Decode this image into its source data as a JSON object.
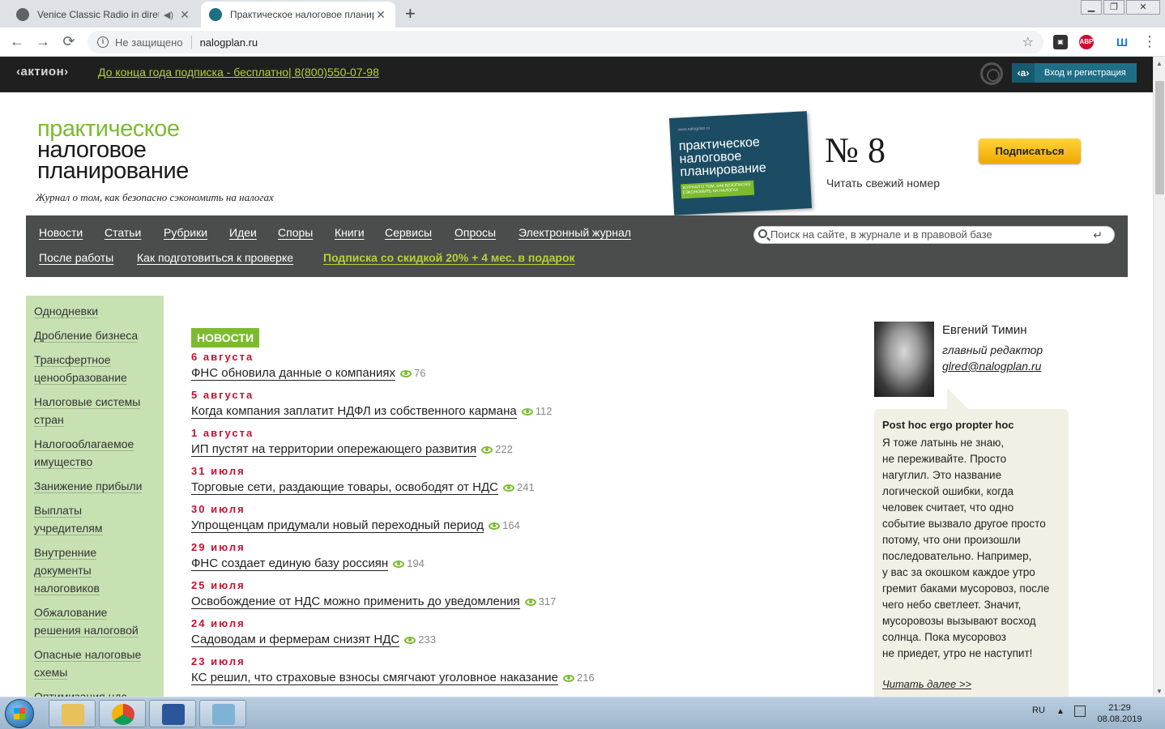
{
  "browser": {
    "tabs": [
      {
        "title": "Venice Classic Radio in diretta",
        "favicon_color": "#5f6368",
        "audio": "◀)",
        "close": "✕"
      },
      {
        "title": "Практическое налоговое планир",
        "favicon_color": "#1e6f86",
        "close": "✕"
      }
    ],
    "new_tab": "+",
    "window_buttons": {
      "minimize": "▁",
      "restore": "❐",
      "close": "✕"
    },
    "nav": {
      "back": "←",
      "forward": "→",
      "reload": "⟳"
    },
    "address": {
      "info": "i",
      "security_label": "Не защищено",
      "url": "nalogplan.ru",
      "star": "☆"
    },
    "extensions": [
      {
        "name": "extension-icon",
        "label": "▣",
        "color": "#333333"
      },
      {
        "name": "adblock-icon",
        "label": "ABP",
        "color": "#c8102e"
      },
      {
        "name": "translate-icon",
        "label": "Ш",
        "color": "#1a73e8"
      }
    ],
    "menu": "⋮"
  },
  "topbar": {
    "logo": "‹актион›",
    "promo": "До конца года подписка - бесплатно| 8(800)550-07-98",
    "login": {
      "mark": "‹a›",
      "label": "Вход и регистрация"
    }
  },
  "header": {
    "logo_lines": [
      "практическое",
      "налоговое",
      "планирование"
    ],
    "tagline": "Журнал о том, как безопасно сэкономить на налогах",
    "cover": {
      "url": "www.nalogplan.ru",
      "title": "практическое налоговое планирование",
      "strip": "ЖУРНАЛ О ТОМ, КАК БЕЗОПАСНО СЭКОНОМИТЬ НА НАЛОГАХ"
    },
    "issue": "№ 8",
    "read_fresh": "Читать свежий номер",
    "subscribe": "Подписаться"
  },
  "nav": {
    "row1": [
      "Новости",
      "Статьи",
      "Рубрики",
      "Идеи",
      "Споры",
      "Книги",
      "Сервисы",
      "Опросы",
      "Электронный журнал"
    ],
    "row2": [
      "После работы",
      "Как подготовиться к проверке"
    ],
    "highlight": "Подписка со скидкой 20% + 4 мес. в подарок",
    "search_placeholder": "Поиск на сайте, в журнале и в правовой базе",
    "search_enter": "↵"
  },
  "sidebar": {
    "items": [
      [
        "Однодневки"
      ],
      [
        "Дробление бизнеса"
      ],
      [
        "Трансфертное",
        "ценообразование"
      ],
      [
        "Налоговые системы",
        "стран"
      ],
      [
        "Налогооблагаемое",
        "имущество"
      ],
      [
        "Занижение прибыли"
      ],
      [
        "Выплаты",
        "учредителям"
      ],
      [
        "Внутренние",
        "документы",
        "налоговиков"
      ],
      [
        "Обжалование",
        "решения налоговой"
      ],
      [
        "Опасные налоговые",
        "схемы"
      ],
      [
        "Оптимизация ндс"
      ]
    ]
  },
  "news": {
    "badge": "НОВОСТИ",
    "items": [
      {
        "date": "6 августа",
        "title": "ФНС обновила данные о компаниях",
        "views": "76"
      },
      {
        "date": "5 августа",
        "title": "Когда компания заплатит НДФЛ из собственного кармана",
        "views": "112"
      },
      {
        "date": "1 августа",
        "title": "ИП пустят на территории опережающего развития",
        "views": "222"
      },
      {
        "date": "31 июля",
        "title": "Торговые сети, раздающие товары, освободят от НДС",
        "views": "241"
      },
      {
        "date": "30 июля",
        "title": "Упрощенцам придумали новый переходный период",
        "views": "164"
      },
      {
        "date": "29 июля",
        "title": "ФНС создает единую базу россиян",
        "views": "194"
      },
      {
        "date": "25 июля",
        "title": "Освобождение от НДС можно применить до уведомления",
        "views": "317"
      },
      {
        "date": "24 июля",
        "title": "Садоводам и фермерам снизят НДС",
        "views": "233"
      },
      {
        "date": "23 июля",
        "title": "КС решил, что страховые взносы смягчают уголовное наказание",
        "views": "216"
      }
    ]
  },
  "editor": {
    "name": "Евгений Тимин",
    "role": "главный редактор",
    "email": "glred@nalogplan.ru",
    "quote_title": "Post hoc ergo propter hoc",
    "quote_body": "Я тоже латынь не знаю,\nне переживайте. Просто\nнагуглил. Это название\nлогической ошибки, когда\nчеловек считает, что одно\nсобытие вызвало другое просто\nпотому, что они произошли\nпоследовательно. Например,\nу вас за окошком каждое утро\nгремит баками мусоровоз, после\nчего небо светлеет. Значит,\nмусоровозы вызывают восход\nсолнца. Пока мусоровоз\nне приедет, утро не наступит!",
    "read_more": "Читать далее >>"
  },
  "taskbar": {
    "apps": [
      {
        "name": "explorer-icon",
        "color": "#e8c15a"
      },
      {
        "name": "chrome-icon",
        "color": "#db4437"
      },
      {
        "name": "word-icon",
        "color": "#2b579a"
      },
      {
        "name": "notepad-icon",
        "color": "#7fb3d5"
      }
    ],
    "lang": "RU",
    "tray_arrow": "▲",
    "time": "21:29",
    "date": "08.08.2019"
  },
  "colors": {
    "accent_green": "#7cbb2f",
    "nav_bg": "#4a4d4c",
    "date_red": "#c8102e",
    "promo": "#b5d334"
  }
}
